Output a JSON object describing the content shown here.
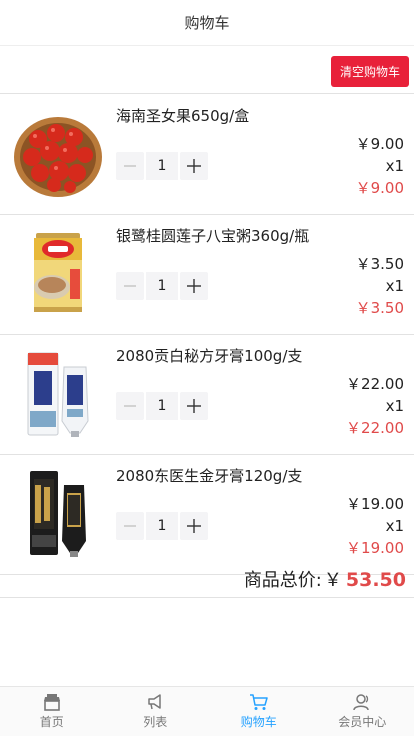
{
  "header": {
    "title": "购物车"
  },
  "toolbar": {
    "clear_label": "清空购物车"
  },
  "items": [
    {
      "name": "海南圣女果650g/盒",
      "quantity": "1",
      "unit_price": "￥9.00",
      "count": "x1",
      "subtotal": "￥9.00",
      "image": "cherry-tomatoes-image"
    },
    {
      "name": "银鹭桂圆莲子八宝粥360g/瓶",
      "quantity": "1",
      "unit_price": "￥3.50",
      "count": "x1",
      "subtotal": "￥3.50",
      "image": "congee-can-image"
    },
    {
      "name": "2080贡白秘方牙膏100g/支",
      "quantity": "1",
      "unit_price": "￥22.00",
      "count": "x1",
      "subtotal": "￥22.00",
      "image": "white-toothpaste-image"
    },
    {
      "name": "2080东医生金牙膏120g/支",
      "quantity": "1",
      "unit_price": "￥19.00",
      "count": "x1",
      "subtotal": "￥19.00",
      "image": "black-toothpaste-image"
    }
  ],
  "summary": {
    "label": "商品总价:",
    "currency": "￥",
    "amount": "53.50"
  },
  "tabbar": {
    "tabs": [
      {
        "label": "首页",
        "icon": "home-icon"
      },
      {
        "label": "列表",
        "icon": "megaphone-icon"
      },
      {
        "label": "购物车",
        "icon": "cart-icon",
        "active": true
      },
      {
        "label": "会员中心",
        "icon": "user-icon"
      }
    ]
  },
  "colors": {
    "accent_red": "#e8213a",
    "price_red": "#e04a4a",
    "active_blue": "#26a2ff"
  }
}
